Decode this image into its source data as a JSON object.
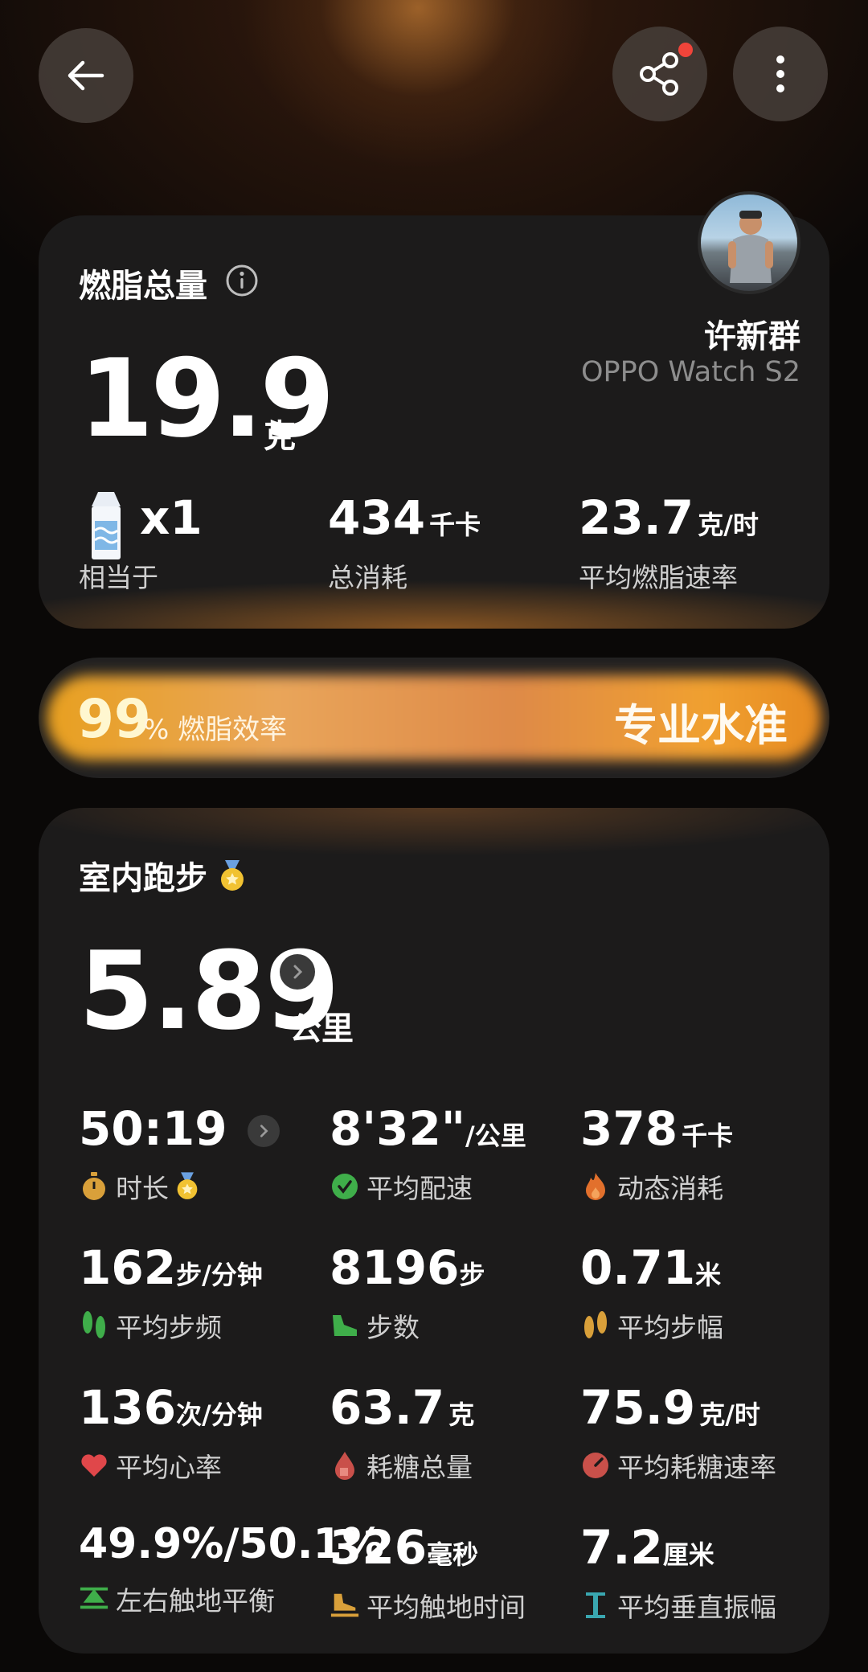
{
  "header": {
    "back_icon": "arrow-left-icon",
    "share_icon": "share-icon",
    "more_icon": "more-vertical-icon"
  },
  "fat_card": {
    "title": "燃脂总量",
    "info_icon": "info-icon",
    "value": "19.9",
    "unit": "克",
    "user_name": "许新群",
    "device": "OPPO Watch S2",
    "stats": [
      {
        "value": "x1",
        "unit": "",
        "label": "相当于",
        "icon": "milk-carton-icon"
      },
      {
        "value": "434",
        "unit": "千卡",
        "label": "总消耗"
      },
      {
        "value": "23.7",
        "unit": "克/时",
        "label": "平均燃脂速率"
      }
    ]
  },
  "efficiency": {
    "value": "99",
    "label": "% 燃脂效率",
    "level": "专业水准",
    "percent": 99
  },
  "run_card": {
    "title": "室内跑步",
    "medal_icon": "medal-icon",
    "distance": "5.89",
    "distance_unit": "公里",
    "metrics": [
      {
        "value": "50:19",
        "unit": "",
        "label": "时长",
        "icon": "stopwatch-icon",
        "color": "#d9a03a"
      },
      {
        "value": "8'32\"",
        "unit": "/公里",
        "label": "平均配速",
        "icon": "pace-check-icon",
        "color": "#3fae4a"
      },
      {
        "value": "378",
        "unit": "千卡",
        "label": "动态消耗",
        "icon": "flame-icon",
        "color": "#e2702c"
      },
      {
        "value": "162",
        "unit": "步/分钟",
        "label": "平均步频",
        "icon": "footprints-icon",
        "color": "#3fae4a"
      },
      {
        "value": "8196",
        "unit": "步",
        "label": "步数",
        "icon": "shoe-icon",
        "color": "#3fae4a"
      },
      {
        "value": "0.71",
        "unit": "米",
        "label": "平均步幅",
        "icon": "footprints-icon",
        "color": "#d9a03a"
      },
      {
        "value": "136",
        "unit": "次/分钟",
        "label": "平均心率",
        "icon": "heart-icon",
        "color": "#e0474a"
      },
      {
        "value": "63.7",
        "unit": "克",
        "label": "耗糖总量",
        "icon": "sugar-drop-icon",
        "color": "#c9504a"
      },
      {
        "value": "75.9",
        "unit": "克/时",
        "label": "平均耗糖速率",
        "icon": "gauge-icon",
        "color": "#c9504a"
      },
      {
        "value": "49.9%/50.1%",
        "unit": "",
        "label": "左右触地平衡",
        "icon": "balance-icon",
        "color": "#3fae4a"
      },
      {
        "value": "326",
        "unit": "毫秒",
        "label": "平均触地时间",
        "icon": "ground-contact-icon",
        "color": "#d9a03a"
      },
      {
        "value": "7.2",
        "unit": "厘米",
        "label": "平均垂直振幅",
        "icon": "vertical-icon",
        "color": "#3aa7b0"
      }
    ]
  }
}
